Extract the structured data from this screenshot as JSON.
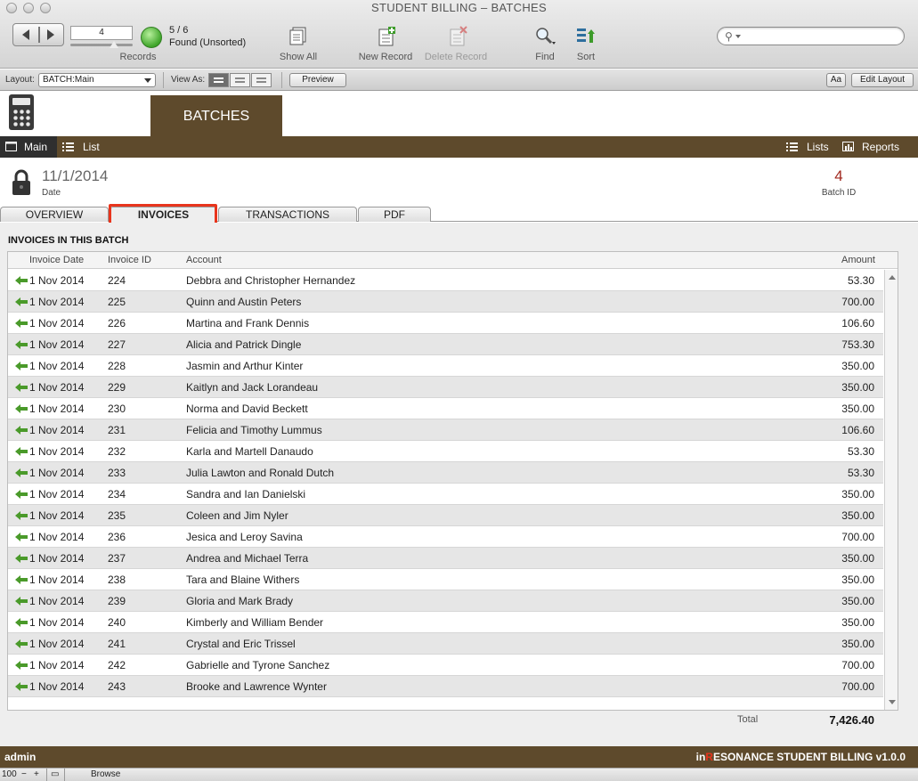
{
  "window": {
    "title": "STUDENT BILLING – BATCHES"
  },
  "toolbar": {
    "current_record": "4",
    "found_count": "5 / 6",
    "found_status": "Found (Unsorted)",
    "records_label": "Records",
    "show_all_label": "Show All",
    "new_record_label": "New Record",
    "delete_record_label": "Delete Record",
    "find_label": "Find",
    "sort_label": "Sort",
    "search_placeholder": ""
  },
  "layout_bar": {
    "layout_label": "Layout:",
    "layout_value": "BATCH:Main",
    "view_as_label": "View As:",
    "preview_label": "Preview",
    "font_button": "Aa",
    "edit_layout_label": "Edit Layout"
  },
  "header": {
    "batch_tab": "BATCHES"
  },
  "nav": {
    "main_label": "Main",
    "list_label": "List",
    "lists_label": "Lists",
    "reports_label": "Reports"
  },
  "record": {
    "date_value": "11/1/2014",
    "date_label": "Date",
    "batch_id_value": "4",
    "batch_id_label": "Batch ID"
  },
  "tabs": [
    {
      "label": "OVERVIEW"
    },
    {
      "label": "INVOICES"
    },
    {
      "label": "TRANSACTIONS"
    },
    {
      "label": "PDF"
    }
  ],
  "active_tab": "INVOICES",
  "invoices": {
    "section_title": "INVOICES IN THIS BATCH",
    "columns": {
      "date": "Invoice Date",
      "id": "Invoice ID",
      "account": "Account",
      "amount": "Amount"
    },
    "rows": [
      {
        "date": "1 Nov 2014",
        "id": "224",
        "account": "Debbra and Christopher Hernandez",
        "amount": "53.30"
      },
      {
        "date": "1 Nov 2014",
        "id": "225",
        "account": "Quinn and Austin Peters",
        "amount": "700.00"
      },
      {
        "date": "1 Nov 2014",
        "id": "226",
        "account": "Martina and Frank Dennis",
        "amount": "106.60"
      },
      {
        "date": "1 Nov 2014",
        "id": "227",
        "account": "Alicia and Patrick Dingle",
        "amount": "753.30"
      },
      {
        "date": "1 Nov 2014",
        "id": "228",
        "account": "Jasmin and Arthur Kinter",
        "amount": "350.00"
      },
      {
        "date": "1 Nov 2014",
        "id": "229",
        "account": "Kaitlyn and Jack Lorandeau",
        "amount": "350.00"
      },
      {
        "date": "1 Nov 2014",
        "id": "230",
        "account": "Norma and David Beckett",
        "amount": "350.00"
      },
      {
        "date": "1 Nov 2014",
        "id": "231",
        "account": "Felicia and Timothy Lummus",
        "amount": "106.60"
      },
      {
        "date": "1 Nov 2014",
        "id": "232",
        "account": "Karla and Martell Danaudo",
        "amount": "53.30"
      },
      {
        "date": "1 Nov 2014",
        "id": "233",
        "account": "Julia Lawton and Ronald Dutch",
        "amount": "53.30"
      },
      {
        "date": "1 Nov 2014",
        "id": "234",
        "account": "Sandra and Ian Danielski",
        "amount": "350.00"
      },
      {
        "date": "1 Nov 2014",
        "id": "235",
        "account": "Coleen and Jim Nyler",
        "amount": "350.00"
      },
      {
        "date": "1 Nov 2014",
        "id": "236",
        "account": "Jesica and Leroy Savina",
        "amount": "700.00"
      },
      {
        "date": "1 Nov 2014",
        "id": "237",
        "account": "Andrea and Michael Terra",
        "amount": "350.00"
      },
      {
        "date": "1 Nov 2014",
        "id": "238",
        "account": "Tara and Blaine Withers",
        "amount": "350.00"
      },
      {
        "date": "1 Nov 2014",
        "id": "239",
        "account": "Gloria and Mark Brady",
        "amount": "350.00"
      },
      {
        "date": "1 Nov 2014",
        "id": "240",
        "account": "Kimberly and William Bender",
        "amount": "350.00"
      },
      {
        "date": "1 Nov 2014",
        "id": "241",
        "account": "Crystal and Eric Trissel",
        "amount": "350.00"
      },
      {
        "date": "1 Nov 2014",
        "id": "242",
        "account": "Gabrielle and Tyrone Sanchez",
        "amount": "700.00"
      },
      {
        "date": "1 Nov 2014",
        "id": "243",
        "account": "Brooke and Lawrence Wynter",
        "amount": "700.00"
      }
    ],
    "total_label": "Total",
    "total_value": "7,426.40"
  },
  "footer": {
    "user": "admin",
    "brand_prefix": "in",
    "brand_r": "R",
    "brand_rest": "ESONANCE STUDENT BILLING v1.0.0"
  },
  "statusbar": {
    "zoom": "100",
    "mode": "Browse"
  },
  "colors": {
    "brown": "#5e4a2c",
    "highlight": "#e8351d",
    "batch_id": "#a0281e",
    "arrow_green": "#4a9a2a"
  }
}
